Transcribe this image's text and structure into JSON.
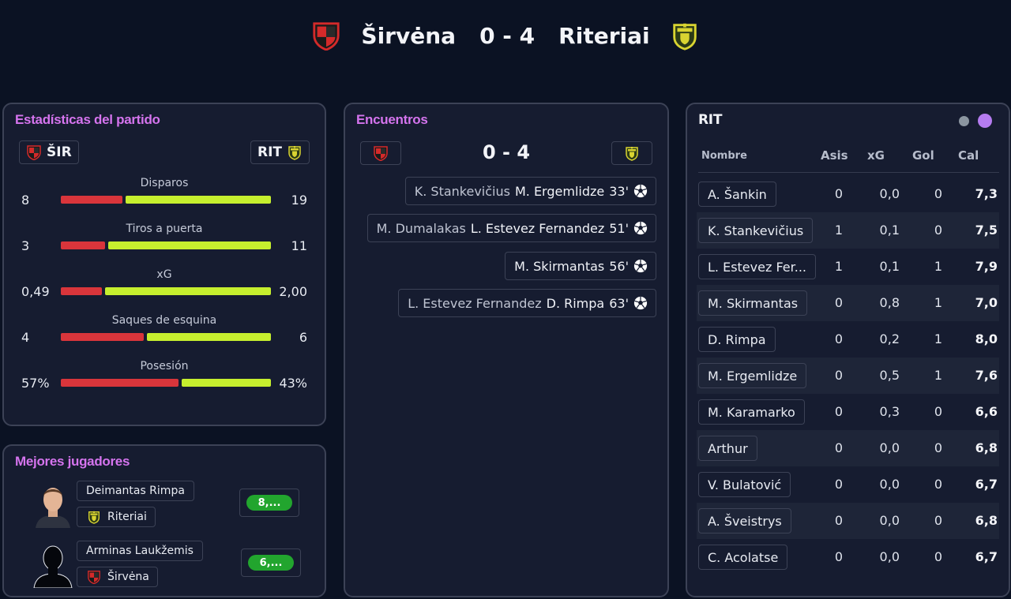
{
  "header": {
    "home_team": "Širvėna",
    "away_team": "Riteriai",
    "score": "0 - 4"
  },
  "colors": {
    "home_bar": "#d9353b",
    "away_bar": "#c6ef2e",
    "accent_title": "#d574ee",
    "rating_good": "#22a52e"
  },
  "stats": {
    "title": "Estadísticas del partido",
    "home_abbr": "ŠIR",
    "away_abbr": "RIT",
    "rows": [
      {
        "label": "Disparos",
        "home": "8",
        "away": "19",
        "home_share": 0.296,
        "away_share": 0.704
      },
      {
        "label": "Tiros a puerta",
        "home": "3",
        "away": "11",
        "home_share": 0.214,
        "away_share": 0.786
      },
      {
        "label": "xG",
        "home": "0,49",
        "away": "2,00",
        "home_share": 0.197,
        "away_share": 0.803
      },
      {
        "label": "Saques de esquina",
        "home": "4",
        "away": "6",
        "home_share": 0.4,
        "away_share": 0.6
      },
      {
        "label": "Posesión",
        "home": "57%",
        "away": "43%",
        "home_share": 0.57,
        "away_share": 0.43
      }
    ]
  },
  "best_players": {
    "title": "Mejores jugadores",
    "players": [
      {
        "name": "Deimantas Rimpa",
        "team": "Riteriai",
        "rating": "8,..."
      },
      {
        "name": "Arminas Laukžemis",
        "team": "Širvėna",
        "rating": "6,..."
      }
    ]
  },
  "encounters": {
    "title": "Encuentros",
    "score": "0 - 4",
    "events": [
      {
        "assist": "K. Stankevičius",
        "scorer": "M. Ergemlidze",
        "minute": "33'",
        "icon": "soccer-ball-icon"
      },
      {
        "assist": "M. Dumalakas",
        "scorer": "L. Estevez Fernandez",
        "minute": "51'",
        "icon": "soccer-ball-icon"
      },
      {
        "assist": "",
        "scorer": "M. Skirmantas",
        "minute": "56'",
        "icon": "soccer-ball-icon"
      },
      {
        "assist": "L. Estevez Fernandez",
        "scorer": "D. Rimpa",
        "minute": "63'",
        "icon": "soccer-ball-icon"
      }
    ]
  },
  "rit_table": {
    "title": "RIT",
    "columns": {
      "name": "Nombre",
      "assists": "Asis",
      "xg": "xG",
      "goals": "Gol",
      "rating": "Cal"
    },
    "rows": [
      {
        "name": "A. Šankin",
        "assists": "0",
        "xg": "0,0",
        "goals": "0",
        "rating": "7,3"
      },
      {
        "name": "K. Stankevičius",
        "assists": "1",
        "xg": "0,1",
        "goals": "0",
        "rating": "7,5"
      },
      {
        "name": "L. Estevez Fer...",
        "assists": "1",
        "xg": "0,1",
        "goals": "1",
        "rating": "7,9"
      },
      {
        "name": "M. Skirmantas",
        "assists": "0",
        "xg": "0,8",
        "goals": "1",
        "rating": "7,0"
      },
      {
        "name": "D. Rimpa",
        "assists": "0",
        "xg": "0,2",
        "goals": "1",
        "rating": "8,0"
      },
      {
        "name": "M. Ergemlidze",
        "assists": "0",
        "xg": "0,5",
        "goals": "1",
        "rating": "7,6"
      },
      {
        "name": "M. Karamarko",
        "assists": "0",
        "xg": "0,3",
        "goals": "0",
        "rating": "6,6"
      },
      {
        "name": "Arthur",
        "assists": "0",
        "xg": "0,0",
        "goals": "0",
        "rating": "6,8"
      },
      {
        "name": "V. Bulatović",
        "assists": "0",
        "xg": "0,0",
        "goals": "0",
        "rating": "6,7"
      },
      {
        "name": "A. Šveistrys",
        "assists": "0",
        "xg": "0,0",
        "goals": "0",
        "rating": "6,8"
      },
      {
        "name": "C. Acolatse",
        "assists": "0",
        "xg": "0,0",
        "goals": "0",
        "rating": "6,7"
      }
    ]
  }
}
